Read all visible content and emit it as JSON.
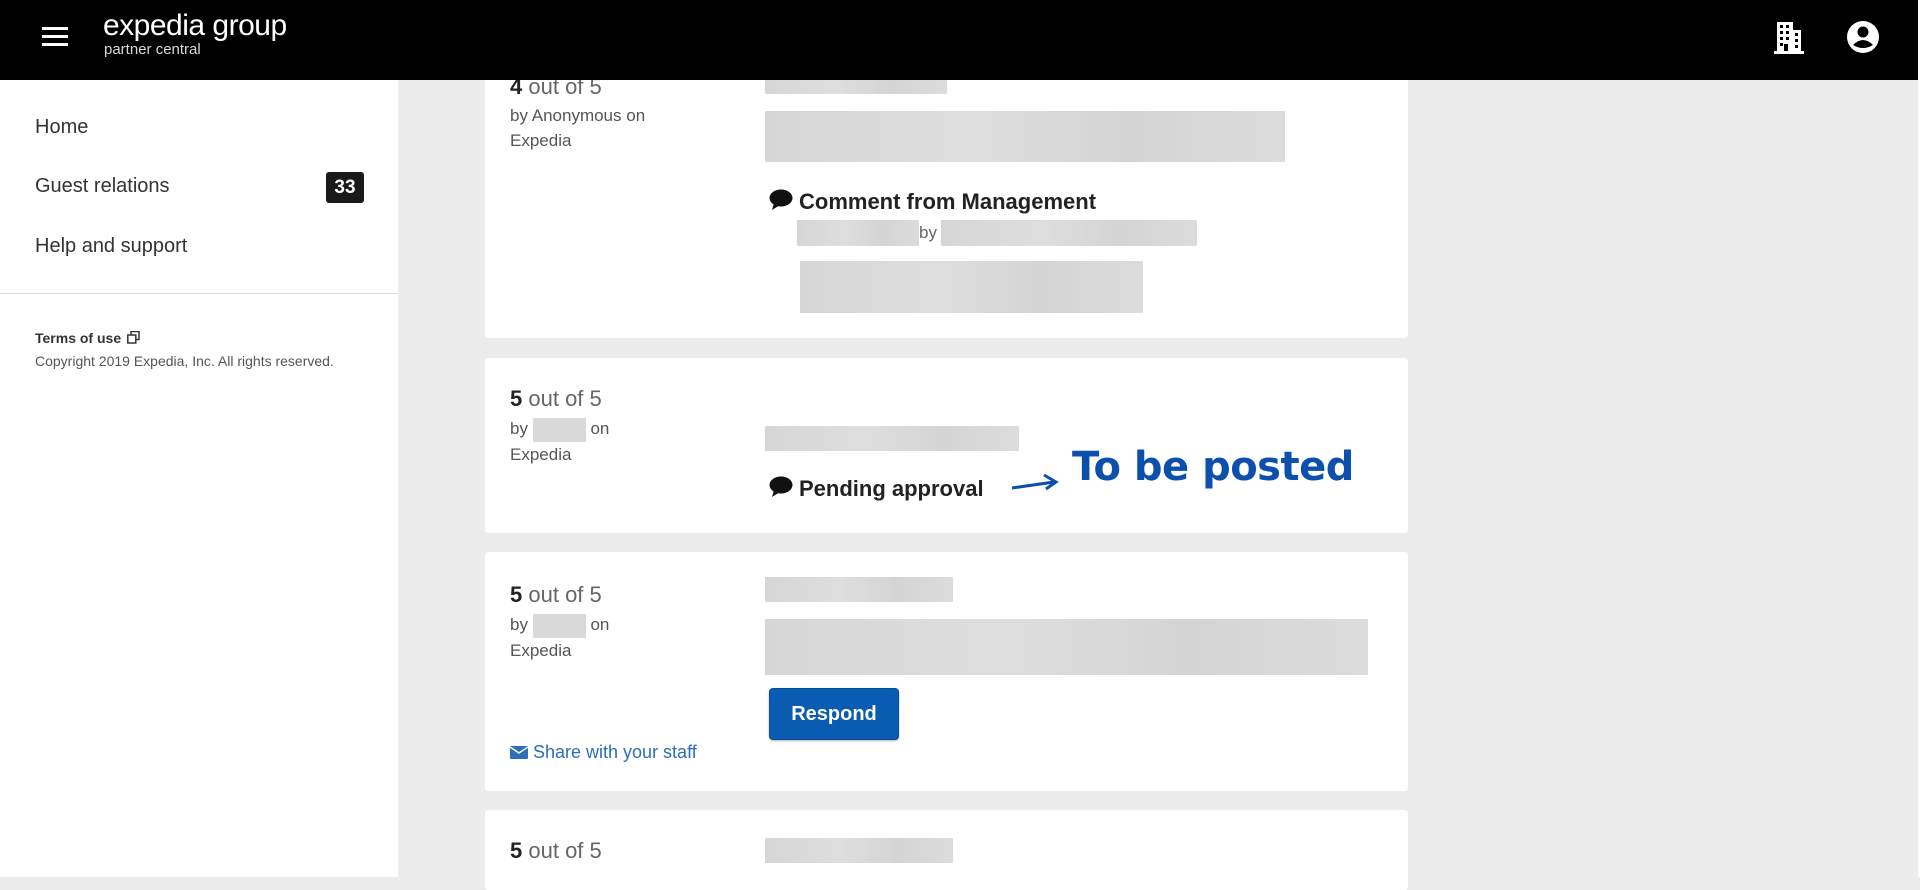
{
  "header": {
    "brand_name": "expedia group",
    "brand_sub": "partner central",
    "menu_icon": "hamburger-menu-icon",
    "property_icon": "building-icon",
    "account_icon": "account-circle-icon"
  },
  "sidebar": {
    "items": [
      {
        "label": "Home"
      },
      {
        "label": "Guest relations",
        "badge": "33"
      },
      {
        "label": "Help and support"
      }
    ],
    "terms_label": "Terms of use",
    "terms_icon": "external-link-icon",
    "copyright": "Copyright 2019 Expedia, Inc. All rights reserved."
  },
  "reviews": [
    {
      "score": "4",
      "score_suffix": "out of 5",
      "byline": "by Anonymous on",
      "source": "Expedia",
      "management_comment_label": "Comment from Management",
      "management_by": "by"
    },
    {
      "score": "5",
      "score_suffix": "out of 5",
      "by": "by",
      "on": "on",
      "source": "Expedia",
      "status_label": "Pending approval"
    },
    {
      "score": "5",
      "score_suffix": "out of 5",
      "by": "by",
      "on": "on",
      "source": "Expedia",
      "respond_label": "Respond",
      "share_label": "Share with your staff"
    },
    {
      "score": "5",
      "score_suffix": "out of 5"
    }
  ],
  "annotation": {
    "text": "To be posted",
    "color": "#0d4fad"
  },
  "colors": {
    "topbar": "#000000",
    "primary_button": "#0a5cb3",
    "link": "#2a6fb8",
    "badge": "#1a1a1a"
  }
}
